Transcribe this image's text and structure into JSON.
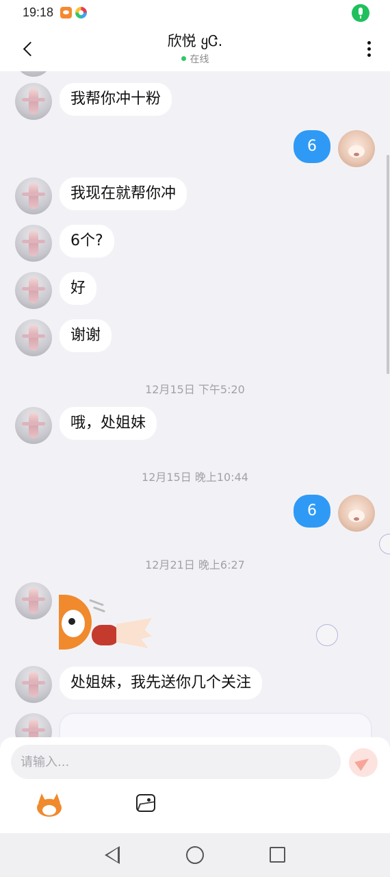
{
  "status_bar": {
    "time": "19:18",
    "icons": [
      "app-notification-icon",
      "multicolor-app-icon",
      "microphone-icon"
    ]
  },
  "header": {
    "title": "欣悦 ყᏣ.",
    "status": "在线"
  },
  "messages": [
    {
      "from": "friend",
      "text": "我帮你冲十粉"
    },
    {
      "from": "me",
      "text": "6"
    },
    {
      "from": "friend",
      "text": "我现在就帮你冲"
    },
    {
      "from": "friend",
      "text": "6个?"
    },
    {
      "from": "friend",
      "text": "好"
    },
    {
      "from": "friend",
      "text": "谢谢"
    },
    {
      "type": "time",
      "text": "12月15日 下午5:20"
    },
    {
      "from": "friend",
      "text": "哦，处姐妹"
    },
    {
      "type": "time",
      "text": "12月15日 晚上10:44"
    },
    {
      "from": "me",
      "text": "6"
    },
    {
      "type": "time",
      "text": "12月21日 晚上6:27"
    },
    {
      "from": "friend",
      "type": "sticker",
      "sticker": "fox-punch-sticker"
    },
    {
      "from": "friend",
      "text": "处姐妹，我先送你几个关注"
    },
    {
      "from": "friend",
      "type": "card"
    }
  ],
  "input": {
    "placeholder": "请输入..."
  },
  "toolbar": {
    "emoji_icon": "fox-emoji-icon",
    "image_icon": "image-icon"
  },
  "colors": {
    "outgoing_bubble": "#2f9af5",
    "incoming_bubble": "#ffffff",
    "online": "#2dc86a",
    "send_button": "#fde3df"
  }
}
